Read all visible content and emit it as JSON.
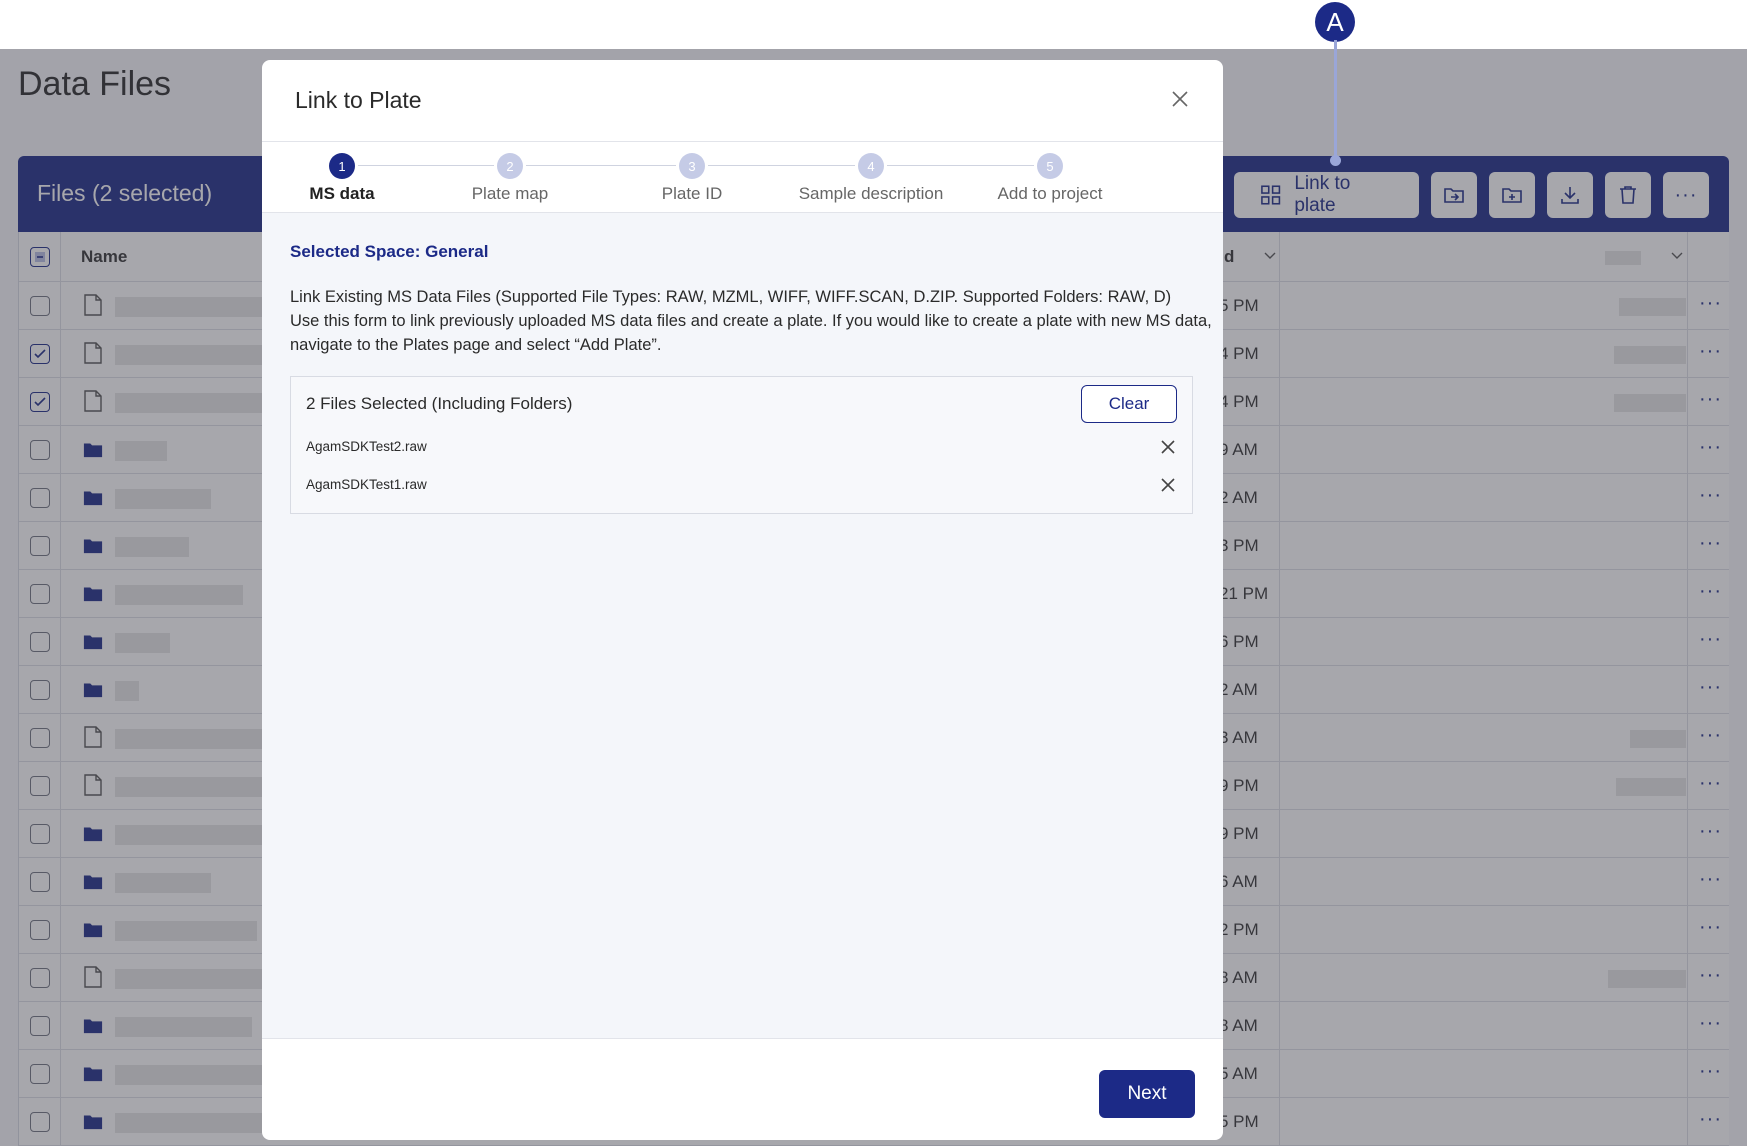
{
  "page": {
    "title": "Data Files",
    "files_count": "Files (2 selected)",
    "toolbar": {
      "link_to_plate_label": "Link to plate"
    },
    "table": {
      "name_header": "Name",
      "date_header_fragment": "d",
      "rows": [
        {
          "type": "file",
          "checked": false,
          "date": "5 PM"
        },
        {
          "type": "file",
          "checked": true,
          "date": "4 PM"
        },
        {
          "type": "file",
          "checked": true,
          "date": "4 PM"
        },
        {
          "type": "folder",
          "checked": false,
          "date": "9 AM"
        },
        {
          "type": "folder",
          "checked": false,
          "date": "2 AM"
        },
        {
          "type": "folder",
          "checked": false,
          "date": "3 PM"
        },
        {
          "type": "folder",
          "checked": false,
          "date": "21 PM"
        },
        {
          "type": "folder",
          "checked": false,
          "date": "6 PM"
        },
        {
          "type": "folder",
          "checked": false,
          "date": "2 AM"
        },
        {
          "type": "file",
          "checked": false,
          "date": "3 AM"
        },
        {
          "type": "file",
          "checked": false,
          "date": "9 PM"
        },
        {
          "type": "folder",
          "checked": false,
          "date": "9 PM"
        },
        {
          "type": "folder",
          "checked": false,
          "date": "6 AM"
        },
        {
          "type": "folder",
          "checked": false,
          "date": "2 PM"
        },
        {
          "type": "file",
          "checked": false,
          "date": "8 AM"
        },
        {
          "type": "folder",
          "checked": false,
          "date": "8 AM"
        },
        {
          "type": "folder",
          "checked": false,
          "date": "5 AM"
        },
        {
          "type": "folder",
          "checked": false,
          "date": "5 PM"
        }
      ],
      "more_label": "···"
    }
  },
  "callout": {
    "label": "A"
  },
  "modal": {
    "title": "Link to Plate",
    "steps": [
      {
        "number": "1",
        "label": "MS data",
        "active": true
      },
      {
        "number": "2",
        "label": "Plate map",
        "active": false
      },
      {
        "number": "3",
        "label": "Plate ID",
        "active": false
      },
      {
        "number": "4",
        "label": "Sample description",
        "active": false
      },
      {
        "number": "5",
        "label": "Add to project",
        "active": false
      }
    ],
    "selected_space": "Selected Space: General",
    "description_lines": [
      "Link Existing MS Data Files (Supported File Types: RAW, MZML, WIFF, WIFF.SCAN, D.ZIP. Supported Folders: RAW, D)",
      "Use this form to link previously uploaded MS data files and create a plate. If you would like to create a plate with new MS data,",
      "navigate to the Plates page and select “Add Plate”."
    ],
    "files_box": {
      "heading": "2 Files Selected (Including Folders)",
      "clear_label": "Clear",
      "files": [
        "AgamSDKTest2.raw",
        "AgamSDKTest1.raw"
      ]
    },
    "next_label": "Next"
  },
  "colors": {
    "brand": "#1c2a87",
    "step_inactive": "#c5cbe6",
    "callout_line": "#9aa6d8"
  }
}
